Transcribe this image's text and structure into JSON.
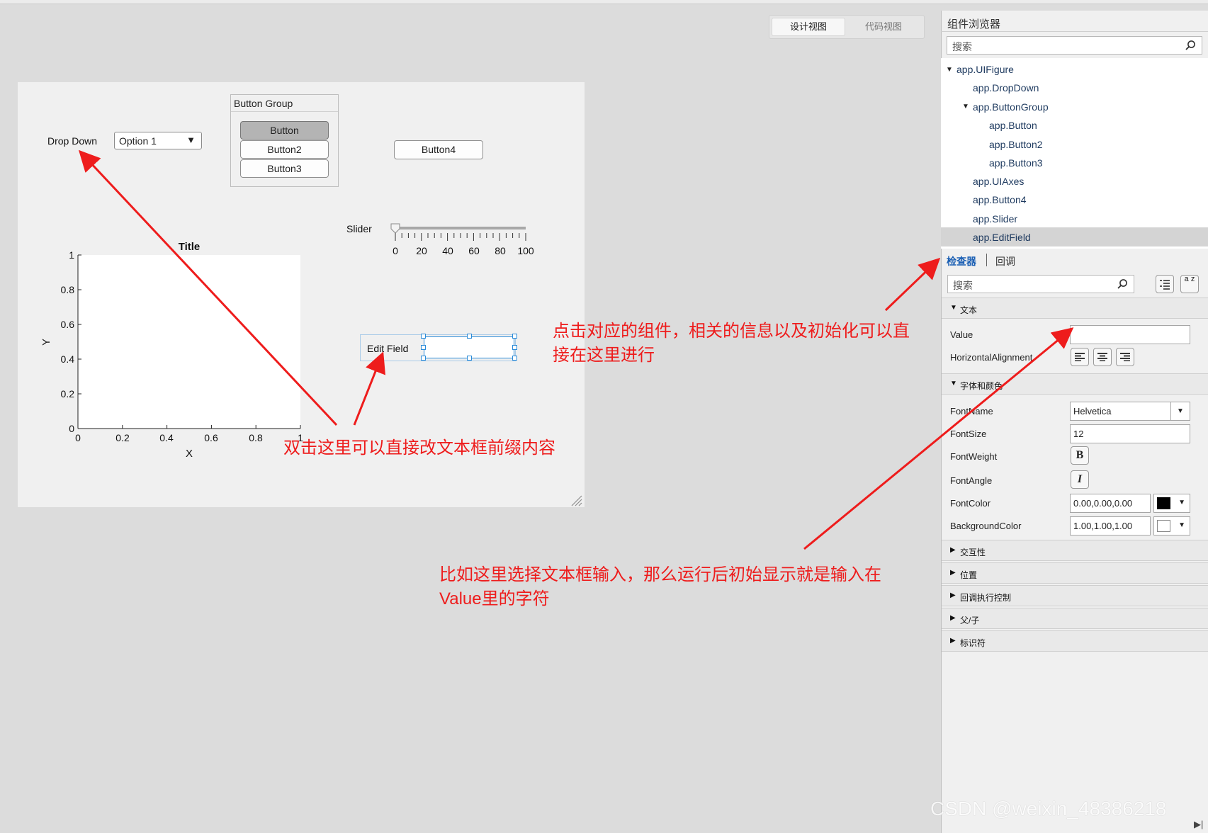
{
  "view_toggle": {
    "design": "设计视图",
    "code": "代码视图"
  },
  "canvas": {
    "dropdown": {
      "label": "Drop Down",
      "value": "Option 1"
    },
    "button_group": {
      "title": "Button Group",
      "buttons": [
        "Button",
        "Button2",
        "Button3"
      ]
    },
    "button4": "Button4",
    "slider": {
      "label": "Slider",
      "ticks": [
        "0",
        "20",
        "40",
        "60",
        "80",
        "100"
      ]
    },
    "edit_field": {
      "label": "Edit Field"
    },
    "axes": {
      "title": "Title",
      "xlabel": "X",
      "ylabel": "Y",
      "xticks": [
        "0",
        "0.2",
        "0.4",
        "0.6",
        "0.8",
        "1"
      ],
      "yticks": [
        "0",
        "0.2",
        "0.4",
        "0.6",
        "0.8",
        "1"
      ]
    }
  },
  "browser": {
    "title": "组件浏览器",
    "search_placeholder": "搜索",
    "tree": [
      "app.UIFigure",
      "app.DropDown",
      "app.ButtonGroup",
      "app.Button",
      "app.Button2",
      "app.Button3",
      "app.UIAxes",
      "app.Button4",
      "app.Slider",
      "app.EditField"
    ]
  },
  "inspector": {
    "tabs": [
      "检查器",
      "回调"
    ],
    "search_placeholder": "搜索",
    "sort_icon_text": "a z",
    "sections": {
      "text": "文本",
      "font": "字体和颜色",
      "interactivity": "交互性",
      "position": "位置",
      "callback_exec": "回调执行控制",
      "parent_child": "父/子",
      "identifiers": "标识符"
    },
    "props": {
      "value": "Value",
      "halign": "HorizontalAlignment",
      "fontname": "FontName",
      "fontname_val": "Helvetica",
      "fontsize": "FontSize",
      "fontsize_val": "12",
      "fontweight": "FontWeight",
      "fontweight_btn": "B",
      "fontangle": "FontAngle",
      "fontangle_btn": "I",
      "fontcolor": "FontColor",
      "fontcolor_val": "0.00,0.00,0.00",
      "bgcolor": "BackgroundColor",
      "bgcolor_val": "1.00,1.00,1.00"
    }
  },
  "annotations": {
    "a1_line1": "点击对应的组件，相关的信息以及初始化可以直",
    "a1_line2": "接在这里进行",
    "a2": "双击这里可以直接改文本框前缀内容",
    "a3_line1": "比如这里选择文本框输入，那么运行后初始显示就是输入在",
    "a3_line2": "Value里的字符"
  },
  "watermark": "CSDN @weixin_48386218",
  "colors": {
    "annotation": "#ee1c1c",
    "selection_handle": "#2a8bd8",
    "tab_active": "#1a5fb4"
  }
}
